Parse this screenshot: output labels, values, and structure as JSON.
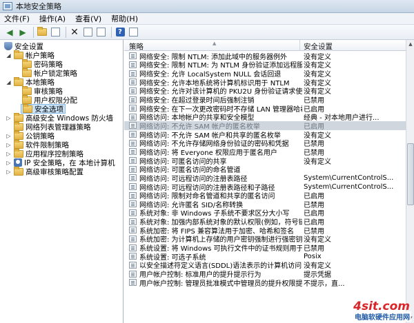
{
  "window": {
    "title": "本地安全策略"
  },
  "menu": [
    "文件(F)",
    "操作(A)",
    "查看(V)",
    "帮助(H)"
  ],
  "tree": {
    "root": "安全设置",
    "items": [
      {
        "label": "帐户策略",
        "expanded": true
      },
      {
        "label": "密码策略"
      },
      {
        "label": "帐户锁定策略"
      },
      {
        "label": "本地策略",
        "expanded": true
      },
      {
        "label": "审核策略"
      },
      {
        "label": "用户权限分配"
      },
      {
        "label": "安全选项",
        "selected": true
      },
      {
        "label": "高级安全 Windows 防火墙"
      },
      {
        "label": "网络列表管理器策略"
      },
      {
        "label": "公钥策略"
      },
      {
        "label": "软件限制策略"
      },
      {
        "label": "应用程序控制策略"
      },
      {
        "label": "IP 安全策略，在 本地计算机"
      },
      {
        "label": "高级审核策略配置"
      }
    ]
  },
  "list": {
    "columns": [
      "策略",
      "安全设置"
    ],
    "rows": [
      {
        "name": "网络安全: 限制 NTLM: 添加此域中的服务器例外",
        "value": "没有定义"
      },
      {
        "name": "网络安全: 限制 NTLM: 为 NTLM 身份验证添加远程服务器例...",
        "value": "没有定义"
      },
      {
        "name": "网络安全: 允许 LocalSystem NULL 会话回退",
        "value": "没有定义"
      },
      {
        "name": "网络安全: 允许本地系统将计算机标识用于 NTLM",
        "value": "没有定义"
      },
      {
        "name": "网络安全: 允许对该计算机的 PKU2U 身份验证请求使用联机...",
        "value": "没有定义"
      },
      {
        "name": "网络安全: 在超过登录时间后强制注销",
        "value": "已禁用"
      },
      {
        "name": "网络安全: 在下一次更改密码时不存储 LAN 管理器哈希值",
        "value": "已启用"
      },
      {
        "name": "网络访问: 本地帐户的共享和安全模型",
        "value": "经典 - 对本地用户进行..."
      },
      {
        "name": "网络访问: 不允许 SAM 帐户的匿名枚举",
        "value": "已启用",
        "selected": true
      },
      {
        "name": "网络访问: 不允许 SAM 帐户和共享的匿名枚举",
        "value": "没有定义"
      },
      {
        "name": "网络访问: 不允许存储网络身份验证的密码和凭据",
        "value": "已禁用"
      },
      {
        "name": "网络访问: 将 Everyone 权限应用于匿名用户",
        "value": "已禁用"
      },
      {
        "name": "网络访问: 可匿名访问的共享",
        "value": "没有定义"
      },
      {
        "name": "网络访问: 可匿名访问的命名管道",
        "value": ""
      },
      {
        "name": "网络访问: 可远程访问的注册表路径",
        "value": "System\\CurrentControlS..."
      },
      {
        "name": "网络访问: 可远程访问的注册表路径和子路径",
        "value": "System\\CurrentControlS..."
      },
      {
        "name": "网络访问: 限制对命名管道和共享的匿名访问",
        "value": "已启用"
      },
      {
        "name": "网络访问: 允许匿名 SID/名称转换",
        "value": "已禁用"
      },
      {
        "name": "系统对象: 非 Windows 子系统不要求区分大小写",
        "value": "已启用"
      },
      {
        "name": "系统对象: 加强内部系统对象的默认权限(例如，符号链接)",
        "value": "已启用"
      },
      {
        "name": "系统加密: 将 FIPS 兼容算法用于加密、哈希和签名",
        "value": "已禁用"
      },
      {
        "name": "系统加密: 为计算机上存储的用户密钥强制进行强密钥保护",
        "value": "没有定义"
      },
      {
        "name": "系统设置: 将 Windows 可执行文件中的证书规则用于软件限...",
        "value": "已禁用"
      },
      {
        "name": "系统设置: 可选子系统",
        "value": "Posix"
      },
      {
        "name": "以安全描述符定义语言(SDDL)语法表示的计算机访问限制",
        "value": "没有定义"
      },
      {
        "name": "用户帐户控制: 标准用户的提升提示行为",
        "value": "提示凭据"
      },
      {
        "name": "用户帐户控制: 管理员批准模式中管理员的提升权限提示的...",
        "value": "不提示，直..."
      }
    ]
  },
  "watermark": {
    "logo": "4sit.com",
    "text": "电脑软硬件应用网"
  }
}
